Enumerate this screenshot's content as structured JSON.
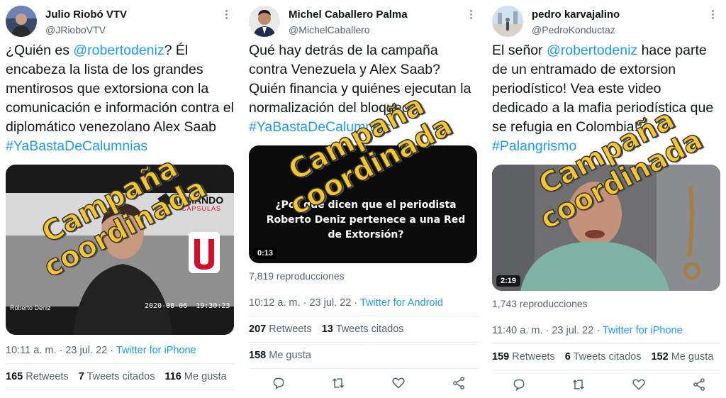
{
  "colors": {
    "link": "#1d9bf0",
    "text": "#0f1419",
    "muted": "#536471",
    "stamp": "#f7c52c"
  },
  "stamp_text": {
    "line1": "Campaña",
    "line2": "coordinada"
  },
  "tweets": [
    {
      "author": "Julio Riobó VTV",
      "handle": "@JRioboVTV",
      "text_parts": [
        "¿Quién es ",
        "@robertodeniz",
        "? Él encabeza la lista de los grandes mentirosos que extorsiona con la comunicación e información contra el diplomático venezolano Alex Saab ",
        "#YaBastaDeCalumnias"
      ],
      "video": {
        "caption_name": "Roberto Deniz",
        "timestamp": "2020-08-06  19:30:23",
        "brand": "ARMANDO",
        "brand_sub": "CÁPSULAS"
      },
      "time": "10:11 a. m.",
      "date": "23 jul. 22",
      "source": "Twitter for iPhone",
      "retweets": "165",
      "retweets_label": "Retweets",
      "quotes": "7",
      "quotes_label": "Tweets citados",
      "likes": "116",
      "likes_label": "Me gusta"
    },
    {
      "author": "Michel Caballero Palma",
      "handle": "@MichelCaballero",
      "text_parts": [
        "Qué hay detrás de la campaña contra Venezuela y Alex Saab? Quién financia y quiénes ejecutan la normalización del bloqueo? ",
        "#YaBastaDeCalumnias"
      ],
      "video": {
        "caption": "¿Por qué dicen que el periodista Roberto Deniz pertenece a una Red de Extorsión?",
        "duration": "0:13"
      },
      "views": "7,819 reproducciones",
      "time": "10:12 a. m.",
      "date": "23 jul. 22",
      "source": "Twitter for Android",
      "retweets": "207",
      "retweets_label": "Retweets",
      "quotes": "13",
      "quotes_label": "Tweets citados",
      "likes": "158",
      "likes_label": "Me gusta"
    },
    {
      "author": "pedro karvajalino",
      "handle": "@PedroKonductaz",
      "text_parts": [
        "El señor ",
        "@robertodeniz",
        " hace parte de un entramado de extorsion periodístico! Vea este video dedicado a la mafia periodística que se refugia en Colombia! ",
        "#Palangrismo"
      ],
      "video": {
        "duration": "2:19"
      },
      "views": "1,743 reproducciones",
      "time": "11:40 a. m.",
      "date": "23 jul. 22",
      "source": "Twitter for iPhone",
      "retweets": "159",
      "retweets_label": "Retweets",
      "quotes": "6",
      "quotes_label": "Tweets citados",
      "likes": "152",
      "likes_label": "Me gusta"
    }
  ]
}
